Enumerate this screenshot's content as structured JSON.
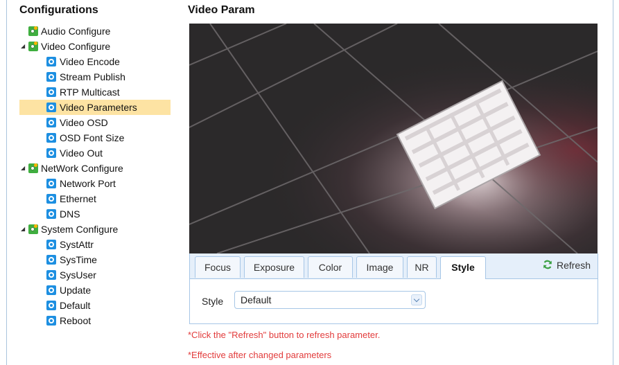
{
  "sidebar": {
    "title": "Configurations",
    "items": [
      {
        "label": "Audio Configure",
        "level": 1,
        "icon": "gear-cluster-icon",
        "expandable": false
      },
      {
        "label": "Video Configure",
        "level": 1,
        "icon": "gear-cluster-icon",
        "expandable": true,
        "expanded": true
      },
      {
        "label": "Video Encode",
        "level": 2,
        "icon": "gear-icon"
      },
      {
        "label": "Stream Publish",
        "level": 2,
        "icon": "gear-icon"
      },
      {
        "label": "RTP Multicast",
        "level": 2,
        "icon": "gear-icon"
      },
      {
        "label": "Video Parameters",
        "level": 2,
        "icon": "gear-icon",
        "selected": true
      },
      {
        "label": "Video OSD",
        "level": 2,
        "icon": "gear-icon"
      },
      {
        "label": "OSD Font Size",
        "level": 2,
        "icon": "gear-icon"
      },
      {
        "label": "Video Out",
        "level": 2,
        "icon": "gear-icon"
      },
      {
        "label": "NetWork Configure",
        "level": 1,
        "icon": "gear-cluster-icon",
        "expandable": true,
        "expanded": true
      },
      {
        "label": "Network Port",
        "level": 2,
        "icon": "gear-icon"
      },
      {
        "label": "Ethernet",
        "level": 2,
        "icon": "gear-icon"
      },
      {
        "label": "DNS",
        "level": 2,
        "icon": "gear-icon"
      },
      {
        "label": "System Configure",
        "level": 1,
        "icon": "gear-cluster-icon",
        "expandable": true,
        "expanded": true
      },
      {
        "label": "SystAttr",
        "level": 2,
        "icon": "gear-icon"
      },
      {
        "label": "SysTime",
        "level": 2,
        "icon": "gear-icon"
      },
      {
        "label": "SysUser",
        "level": 2,
        "icon": "gear-icon"
      },
      {
        "label": "Update",
        "level": 2,
        "icon": "gear-icon"
      },
      {
        "label": "Default",
        "level": 2,
        "icon": "gear-icon"
      },
      {
        "label": "Reboot",
        "level": 2,
        "icon": "gear-icon"
      }
    ]
  },
  "main": {
    "title": "Video Param",
    "tabs": [
      {
        "label": "Focus"
      },
      {
        "label": "Exposure"
      },
      {
        "label": "Color"
      },
      {
        "label": "Image"
      },
      {
        "label": "NR"
      },
      {
        "label": "Style",
        "active": true
      }
    ],
    "refresh_label": "Refresh",
    "style_field": {
      "label": "Style",
      "value": "Default"
    },
    "notes": [
      "*Click the \"Refresh\" button to refresh parameter.",
      "*Effective after changed parameters"
    ]
  },
  "colors": {
    "selected_bg": "#fde3a3",
    "tab_border": "#a6c6e6",
    "note_red": "#e23b3b",
    "leaf_icon_blue": "#1d8fe1",
    "group_icon_green": "#3fae3f"
  }
}
